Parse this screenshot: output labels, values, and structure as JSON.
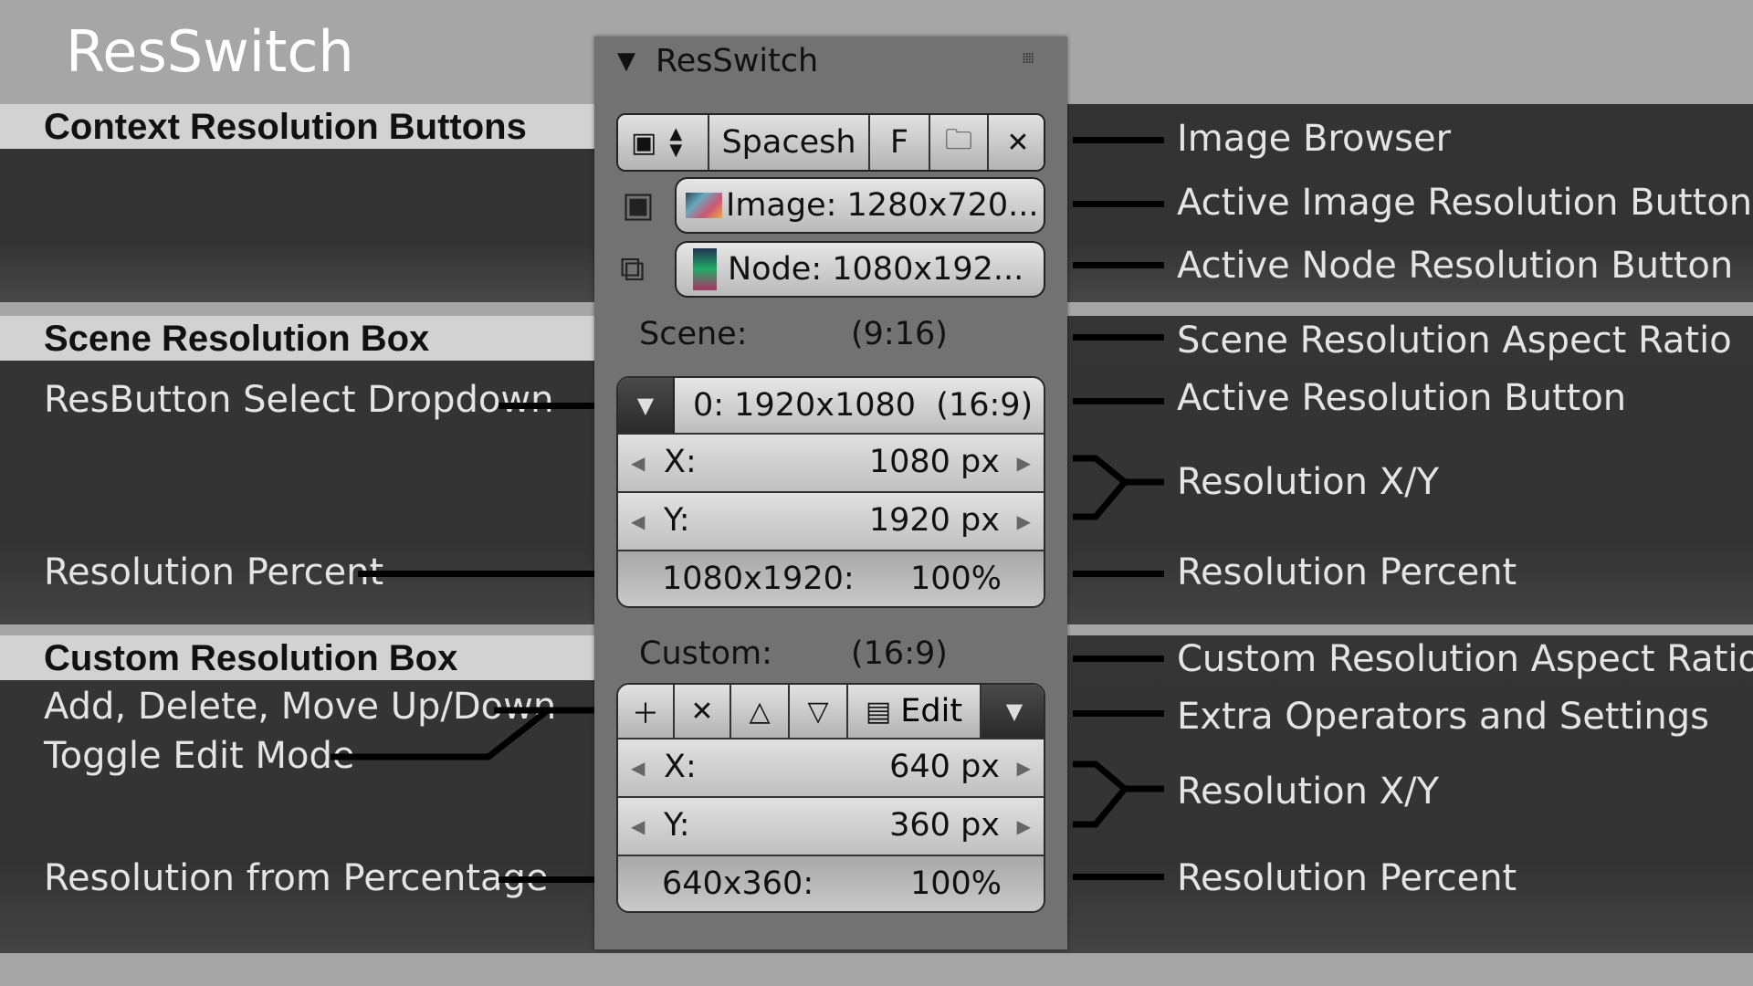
{
  "title": "ResSwitch",
  "sections": {
    "context": "Context Resolution Buttons",
    "scene": "Scene Resolution Box",
    "custom": "Custom Resolution Box"
  },
  "left_labels": {
    "resbutton_select": "ResButton Select Dropdown",
    "resolution_percent": "Resolution Percent",
    "add_delete": "Add, Delete, Move Up/Down",
    "toggle_edit": "Toggle Edit Mode",
    "from_percentage": "Resolution from Percentage"
  },
  "right_labels": {
    "image_browser": "Image Browser",
    "active_image": "Active Image Resolution Button",
    "active_node": "Active Node Resolution Button",
    "scene_aspect": "Scene Resolution Aspect Ratio",
    "active_resolution": "Active Resolution Button",
    "resolution_xy_1": "Resolution X/Y",
    "resolution_percent_1": "Resolution Percent",
    "custom_aspect": "Custom Resolution Aspect Ratio",
    "extra_ops": "Extra Operators and Settings",
    "resolution_xy_2": "Resolution X/Y",
    "resolution_percent_2": "Resolution Percent"
  },
  "panel": {
    "header": "ResSwitch",
    "image_browser": {
      "name": "Spacesh",
      "fake_user": "F"
    },
    "image_button": "Image: 1280x720...",
    "node_button": "Node: 1080x192...",
    "scene": {
      "label": "Scene:",
      "aspect": "(9:16)",
      "active": "0: 1920x1080  (16:9)",
      "x_label": "X:",
      "x_value": "1080 px",
      "y_label": "Y:",
      "y_value": "1920 px",
      "percent_res": "1080x1920:",
      "percent": "100%"
    },
    "custom": {
      "label": "Custom:",
      "aspect": "(16:9)",
      "edit_label": "Edit",
      "x_label": "X:",
      "x_value": "640 px",
      "y_label": "Y:",
      "y_value": "360 px",
      "percent_res": "640x360:",
      "percent": "100%"
    }
  }
}
